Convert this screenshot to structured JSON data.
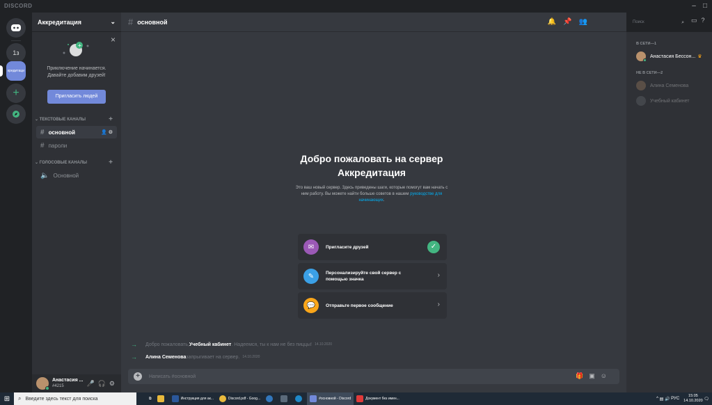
{
  "titlebar": {
    "brand": "DISCORD",
    "min": "–",
    "max": "□"
  },
  "servers": [
    {
      "label": "1з"
    },
    {
      "label": "кредитаци"
    }
  ],
  "sidebar": {
    "server_name": "Аккредитация",
    "promo_text": "Приключение начинается. Давайте добавим друзей!",
    "invite_button": "Пригласить людей",
    "text_category": "текстовые каналы",
    "voice_category": "голосовые каналы",
    "text_channels": [
      "основной",
      "пароли"
    ],
    "voice_channels": [
      "Основной"
    ]
  },
  "user": {
    "name": "Анастасия ...",
    "tag": "#4215"
  },
  "header": {
    "channel": "основной"
  },
  "search": {
    "placeholder": "Поиск"
  },
  "welcome": {
    "title": "Добро пожаловать на сервер Аккредитация",
    "desc_before": "Это ваш новый сервер. Здесь приведены шаги, которые помогут вам начать с ним работу. Вы можете найти больше советов в нашем ",
    "desc_link": "руководстве для начинающих",
    "desc_after": "."
  },
  "cards": [
    {
      "label": "Пригласите друзей",
      "done": true
    },
    {
      "label": "Персонализируйте свой сервер с помощью значка",
      "done": false
    },
    {
      "label": "Отправьте первое сообщение",
      "done": false
    }
  ],
  "messages": [
    {
      "before": "Добро пожаловать, ",
      "name": "Учебный кабинет",
      "after": ". Надеемся, ты к нам не без пиццы!",
      "time": "14.10.2020"
    },
    {
      "before": "",
      "name": "Алина Семенова",
      "after": " запрыгивает на сервер.",
      "time": "14.10.2020"
    }
  ],
  "composer": {
    "placeholder": "Написать #основной"
  },
  "members": {
    "online_label": "В СЕТИ—1",
    "offline_label": "НЕ В СЕТИ—2",
    "online": [
      "Анастасия Бессон..."
    ],
    "offline": [
      "Алина Семенова",
      "Учебный кабинет"
    ]
  },
  "taskbar": {
    "search_placeholder": "Введите здесь текст для поиска",
    "items": [
      "Инструкция для ак...",
      "Discord.pdf - Goog...",
      "#основной - Discord",
      "Документ без имен..."
    ],
    "lang": "РУС",
    "time": "15:05",
    "date": "14.10.2020"
  },
  "colors": {
    "accent": "#7289da",
    "online": "#43b581",
    "link": "#00b0f4"
  }
}
